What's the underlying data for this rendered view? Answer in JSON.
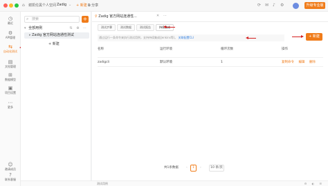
{
  "titlebar": {
    "workspace": "谢凯伦黑个人空间",
    "project": "Zadig",
    "new_label": "新建",
    "share_label": "分享",
    "upgrade_label": "升级专业版"
  },
  "rail": {
    "items": [
      {
        "icon": "clock-icon",
        "glyph": "◷",
        "label": "最近"
      },
      {
        "icon": "api-icon",
        "glyph": "⚙",
        "label": "API管理"
      },
      {
        "icon": "auto-test-icon",
        "glyph": "⇆",
        "label": "自动化测试"
      },
      {
        "icon": "document-icon",
        "glyph": "▤",
        "label": "文档管理"
      },
      {
        "icon": "data-model-icon",
        "glyph": "⊞",
        "label": "数据模型"
      },
      {
        "icon": "settings-icon",
        "glyph": "▣",
        "label": "项目设置"
      },
      {
        "icon": "more-icon",
        "glyph": "⋯",
        "label": "更多"
      },
      {
        "icon": "invite-icon",
        "glyph": "☺",
        "label": "邀请成员"
      },
      {
        "icon": "help-icon",
        "glyph": "?",
        "label": "联系客服"
      }
    ]
  },
  "panel": {
    "search_placeholder": "搜索",
    "tree_root": "全部用例",
    "tree_child": "Zadig 官方网站连通性测试",
    "new_label": "新建"
  },
  "content": {
    "doc_tab": "Zadig 官方网站连通性...",
    "seg_tabs": [
      "测试步骤",
      "测试数据",
      "测试报告",
      "持续集成"
    ],
    "active_seg": 3,
    "desc_text": "通过运行一条命令来执行测试用例，支持持续集成(Jenkins等)。",
    "desc_link": "关联配置CLI",
    "new_task_label": "新建",
    "columns": [
      "名称",
      "运行环境",
      "循环次数",
      "操作"
    ],
    "rows": [
      {
        "name": "zadigcli",
        "env": "默认环境",
        "loops": "1",
        "ops": [
          "复制命令",
          "编辑",
          "删除"
        ]
      }
    ]
  },
  "pager": {
    "total": "共1条数据",
    "page": "1",
    "size": "10 条/页"
  },
  "bottombar": {
    "text": "测试用例"
  },
  "colors": {
    "accent": "#f07c1a",
    "annotation": "#d41f1f"
  }
}
